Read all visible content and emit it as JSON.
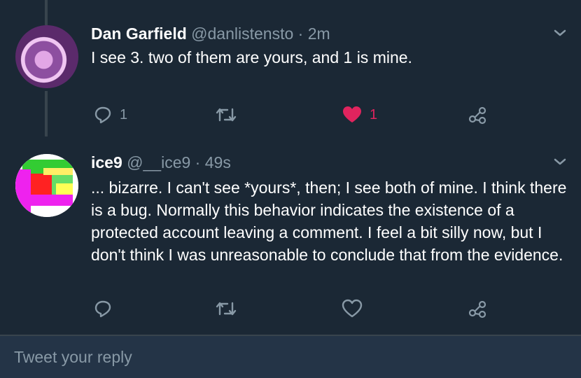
{
  "tweets": [
    {
      "name": "Dan Garfield",
      "handle": "@danlistensto",
      "separator": "·",
      "time": "2m",
      "text": "I see 3. two of them are yours, and 1 is mine.",
      "reply_count": "1",
      "retweet_count": "",
      "like_count": "1",
      "liked": true
    },
    {
      "name": "ice9",
      "handle": "@__ice9",
      "separator": "·",
      "time": "49s",
      "text": "... bizarre.  I can't see *yours*, then; I see both of mine.  I think there is a bug.  Normally this behavior indicates the existence of a protected account leaving a comment.  I feel a bit silly now, but I don't think I was unreasonable to conclude that from the evidence.",
      "reply_count": "",
      "retweet_count": "",
      "like_count": "",
      "liked": false
    }
  ],
  "reply_box": {
    "placeholder": "Tweet your reply"
  },
  "colors": {
    "background": "#1b2835",
    "text": "#ffffff",
    "muted": "#8899a6",
    "like_active": "#e0245e",
    "divider": "#38444d",
    "reply_bar": "#243447"
  },
  "icons": [
    "reply-icon",
    "retweet-icon",
    "like-icon",
    "share-icon",
    "chevron-down-icon"
  ]
}
